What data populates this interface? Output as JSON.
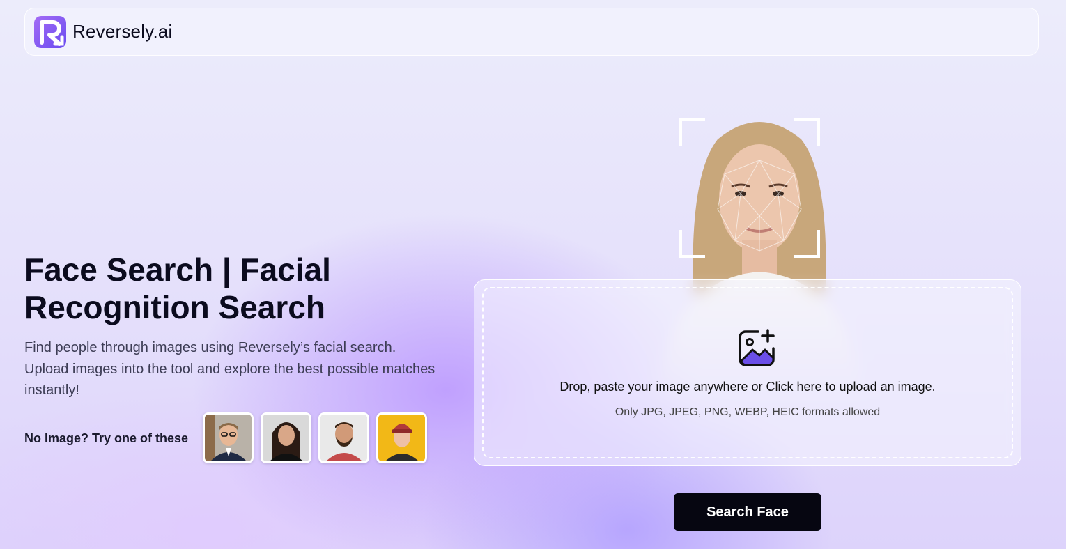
{
  "brand": {
    "name": "Reversely.ai",
    "accent": "#7b5cf5",
    "icon": "logo-r-icon"
  },
  "hero": {
    "title": "Face Search | Facial Recognition Search",
    "description": "Find people through images using Reversely’s facial search. Upload images into the tool and explore the best possible matches instantly!",
    "try_label": "No Image? Try one of these"
  },
  "samples": [
    {
      "name": "sample-man-glasses"
    },
    {
      "name": "sample-woman-dark-hair"
    },
    {
      "name": "sample-man-beard"
    },
    {
      "name": "sample-woman-beanie"
    }
  ],
  "upload": {
    "icon": "image-add-icon",
    "text_prefix": "Drop, paste your image anywhere or Click here to ",
    "link_text": "upload an image.",
    "hint": "Only JPG, JPEG, PNG, WEBP, HEIC formats allowed"
  },
  "actions": {
    "search_label": "Search Face"
  }
}
